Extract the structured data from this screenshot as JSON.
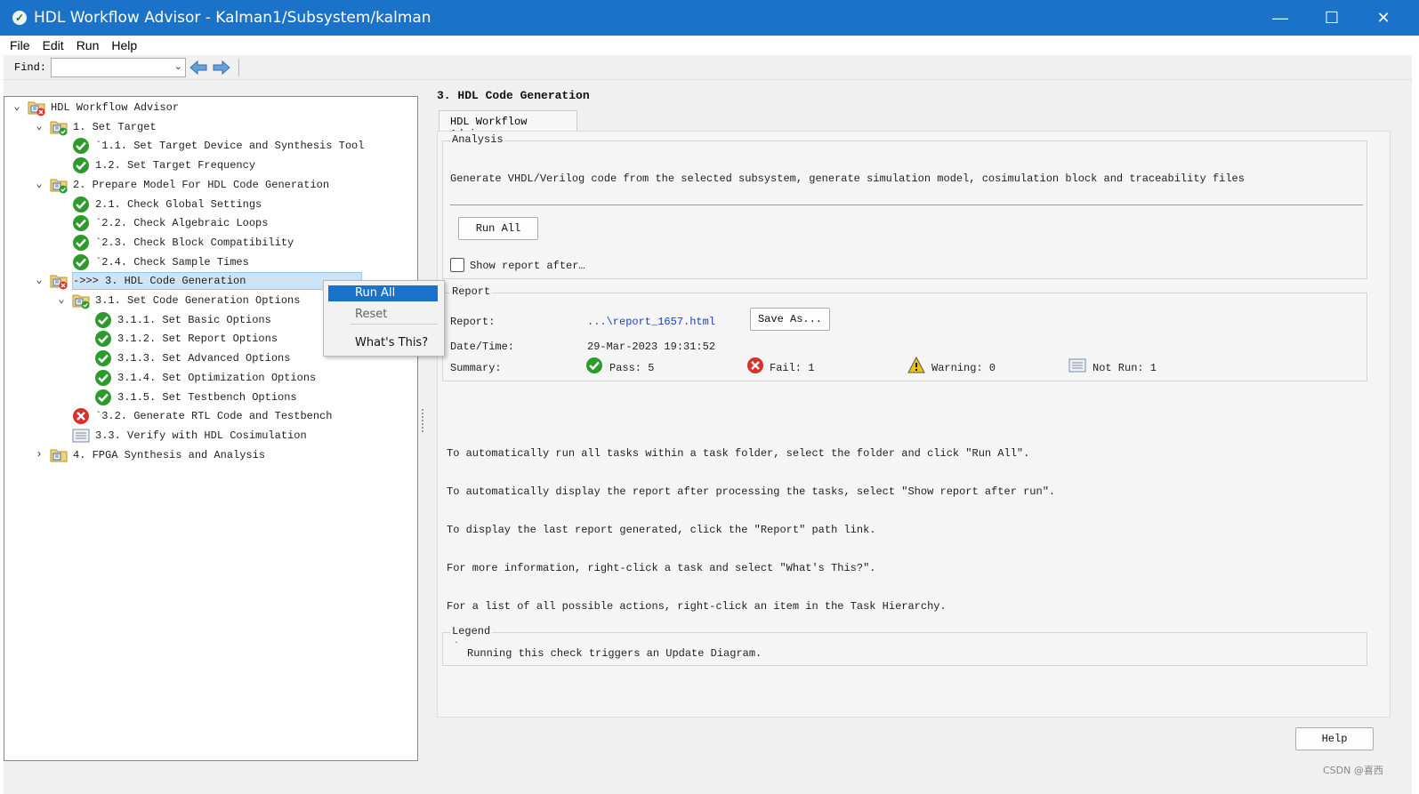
{
  "window": {
    "title": "HDL Workflow Advisor - Kalman1/Subsystem/kalman",
    "minimize": "—",
    "maximize": "☐",
    "close": "✕"
  },
  "menu": [
    "File",
    "Edit",
    "Run",
    "Help"
  ],
  "toolbar": {
    "find_label": "Find:",
    "find_value": ""
  },
  "tree": [
    {
      "label": "HDL Workflow Advisor",
      "status": "folder-fail",
      "expander": "⌄"
    },
    {
      "label": "1. Set Target",
      "status": "folder-pass",
      "expander": "⌄"
    },
    {
      "label": "`1.1. Set Target Device and Synthesis Tool",
      "status": "pass",
      "expander": ""
    },
    {
      "label": "1.2. Set Target Frequency",
      "status": "pass",
      "expander": ""
    },
    {
      "label": "2. Prepare Model For HDL Code Generation",
      "status": "folder-pass",
      "expander": "⌄"
    },
    {
      "label": "2.1. Check Global Settings",
      "status": "pass",
      "expander": ""
    },
    {
      "label": "`2.2. Check Algebraic Loops",
      "status": "pass",
      "expander": ""
    },
    {
      "label": "`2.3. Check Block Compatibility",
      "status": "pass",
      "expander": ""
    },
    {
      "label": "`2.4. Check Sample Times",
      "status": "pass",
      "expander": ""
    },
    {
      "label": "->>> 3. HDL Code Generation",
      "status": "folder-fail",
      "expander": "⌄",
      "selected": true
    },
    {
      "label": "3.1. Set Code Generation Options",
      "status": "folder-pass",
      "expander": "⌄"
    },
    {
      "label": "3.1.1. Set Basic Options",
      "status": "pass",
      "expander": ""
    },
    {
      "label": "3.1.2. Set Report Options",
      "status": "pass",
      "expander": ""
    },
    {
      "label": "3.1.3. Set Advanced Options",
      "status": "pass",
      "expander": ""
    },
    {
      "label": "3.1.4. Set Optimization Options",
      "status": "pass",
      "expander": ""
    },
    {
      "label": "3.1.5. Set Testbench Options",
      "status": "pass",
      "expander": ""
    },
    {
      "label": "`3.2. Generate RTL Code and Testbench",
      "status": "fail",
      "expander": ""
    },
    {
      "label": "3.3. Verify with HDL Cosimulation",
      "status": "notrun",
      "expander": ""
    },
    {
      "label": "4. FPGA Synthesis and Analysis",
      "status": "folder",
      "expander": "›"
    }
  ],
  "context_menu": {
    "items": [
      "Run All",
      "Reset",
      "What's This?"
    ]
  },
  "right": {
    "title": "3. HDL Code Generation",
    "tab": "HDL Workflow Advisor",
    "analysis": {
      "legend": "Analysis",
      "description": "Generate VHDL/Verilog code from the selected subsystem, generate simulation model, cosimulation block and traceability files",
      "run_all_button": "Run All",
      "show_report_label": "Show report after…"
    },
    "report": {
      "legend": "Report",
      "report_label": "Report:",
      "report_link": "...\\report_1657.html",
      "save_as_button": "Save As...",
      "datetime_label": "Date/Time:",
      "datetime_value": "29-Mar-2023 19:31:52",
      "summary_label": "Summary:",
      "pass": "Pass: 5",
      "fail": "Fail: 1",
      "warning": "Warning: 0",
      "not_run": "Not Run: 1"
    },
    "help_lines": [
      "To automatically run all tasks within a task folder, select the folder and click \"Run All\".",
      "To automatically display the report after processing the tasks, select \"Show report after run\".",
      "To display the last report generated, click the \"Report\" path link.",
      "For more information, right-click a task and select \"What's This?\".",
      "For a list of all possible actions, right-click an item in the Task Hierarchy."
    ],
    "legend": {
      "legend": "Legend",
      "tick": "`",
      "text": "Running this check triggers an Update Diagram."
    },
    "help_button": "Help"
  },
  "watermark": "CSDN @喜西",
  "colors": {
    "titlebar": "#1a73c8",
    "pass": "#2e9a2e",
    "fail": "#d9302c",
    "warning": "#f2c200",
    "selection": "#cde4f7",
    "link": "#1a3fbf"
  }
}
